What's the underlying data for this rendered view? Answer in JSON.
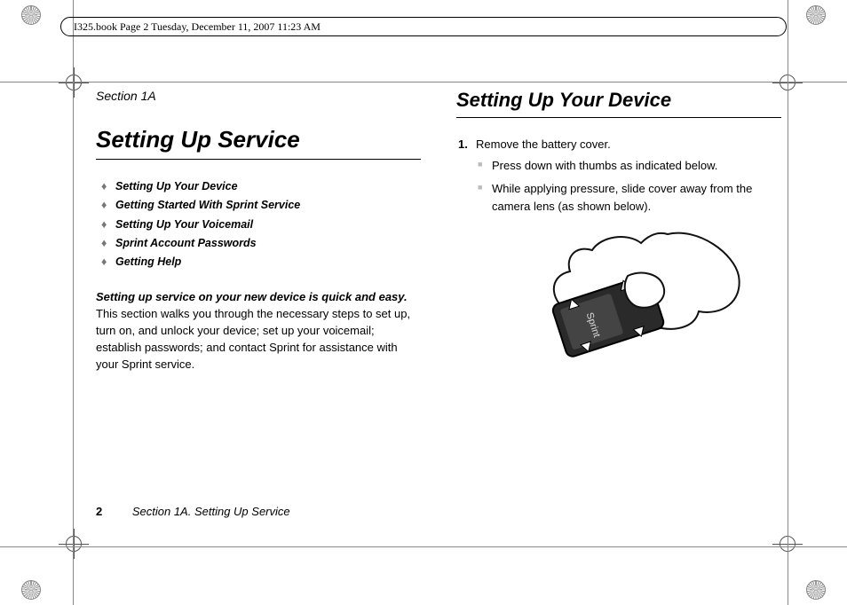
{
  "header": {
    "book_info": "I325.book  Page 2  Tuesday, December 11, 2007  11:23 AM"
  },
  "left_column": {
    "section_label": "Section 1A",
    "title": "Setting Up Service",
    "toc": [
      "Setting Up Your Device",
      "Getting Started With Sprint Service",
      "Setting Up Your Voicemail",
      "Sprint Account Passwords",
      "Getting Help"
    ],
    "intro_lead": "Setting up service on your new device is quick and easy.",
    "intro_rest": " This section walks you through the necessary steps to set up, turn on, and unlock your device; set up your voicemail; establish passwords; and contact Sprint for assistance with your Sprint service."
  },
  "right_column": {
    "title": "Setting Up Your Device",
    "step_number": "1.",
    "step_text": "Remove the battery cover.",
    "substeps": [
      "Press down with thumbs as indicated below.",
      "While applying pressure, slide cover away from the camera lens (as shown below)."
    ],
    "image_brand": "Sprint"
  },
  "footer": {
    "page_number": "2",
    "footer_text": "Section 1A. Setting Up Service"
  }
}
